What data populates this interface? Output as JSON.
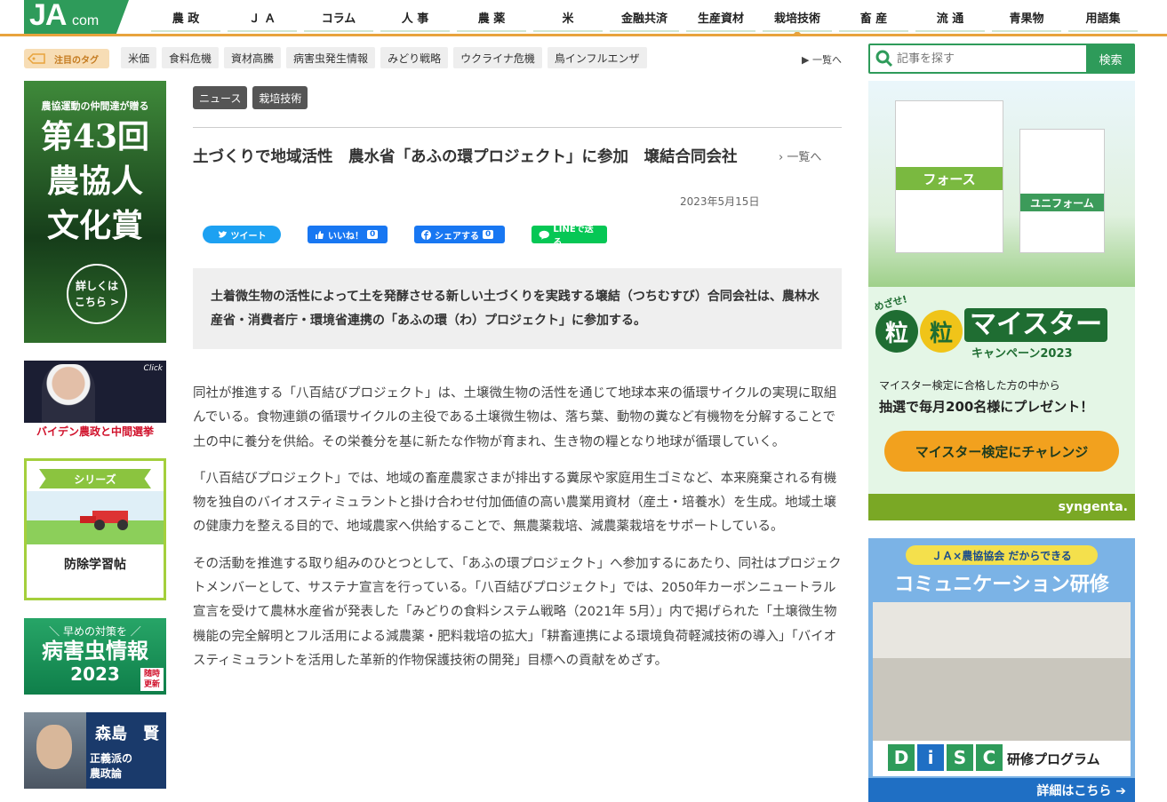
{
  "header": {
    "logo_ja": "JA",
    "logo_com": "com",
    "nav": [
      "農 政",
      "Ｊ Ａ",
      "コラム",
      "人 事",
      "農 薬",
      "米",
      "金融共済",
      "生産資材",
      "栽培技術",
      "畜 産",
      "流 通",
      "青果物",
      "用語集"
    ],
    "active_nav": "栽培技術"
  },
  "tags": {
    "label": "注目のタグ",
    "items": [
      "米価",
      "食料危機",
      "資材高騰",
      "病害虫発生情報",
      "みどり戦略",
      "ウクライナ危機",
      "鳥インフルエンザ"
    ],
    "all_link": "▶ 一覧へ"
  },
  "search": {
    "placeholder": "記事を探す",
    "button": "検索"
  },
  "left_banners": {
    "b1_sub": "農協運動の仲間達が贈る",
    "b1_line1": "第43回",
    "b1_line2": "農協人",
    "b1_line3": "文化賞",
    "b1_circle_1": "詳しくは",
    "b1_circle_2": "こちら >",
    "b2_click": "Click",
    "b2_caption": "バイデン農政と中間選挙",
    "b3_ribbon": "シリーズ",
    "b3_label": "防除学習帖",
    "b4_t1": "＼ 早めの対策を ／",
    "b4_t2": "病害虫情報",
    "b4_t3": "2023",
    "b4_badge_1": "随時",
    "b4_badge_2": "更新",
    "b5_name": "森島　賢",
    "b5_desc_1": "正義派の",
    "b5_desc_2": "農政論"
  },
  "article": {
    "categories": [
      "ニュース",
      "栽培技術"
    ],
    "title": "土づくりで地域活性　農水省「あふの環プロジェクト」に参加　壌結合同会社",
    "back_link": "› 一覧へ",
    "date": "2023年5月15日",
    "share": {
      "tweet": "ツイート",
      "like": "いいね！",
      "like_count": "0",
      "fb_share": "シェアする",
      "fb_share_count": "0",
      "line": "LINEで送る"
    },
    "lead": "土着微生物の活性によって土を発酵させる新しい土づくりを実践する壌結（つちむすび）合同会社は、農林水産省・消費者庁・環境省連携の「あふの環（わ）プロジェクト」に参加する。",
    "paragraphs": [
      "同社が推進する「八百結びプロジェクト」は、土壌微生物の活性を通じて地球本来の循環サイクルの実現に取組んでいる。食物連鎖の循環サイクルの主役である土壌微生物は、落ち葉、動物の糞など有機物を分解することで土の中に養分を供給。その栄養分を基に新たな作物が育まれ、生き物の糧となり地球が循環していく。",
      "「八百結びプロジェクト」では、地域の畜産農家さまが排出する糞尿や家庭用生ゴミなど、本来廃棄される有機物を独自のバイオスティミュラントと掛け合わせ付加価値の高い農業用資材（産土・培養水）を生成。地域土壌の健康力を整える目的で、地域農家へ供給することで、無農薬栽培、減農薬栽培をサポートしている。",
      "その活動を推進する取り組みのひとつとして、「あふの環プロジェクト」へ参加するにあたり、同社はプロジェクトメンバーとして、サステナ宣言を行っている。「八百結びプロジェクト」では、2050年カーボンニュートラル宣言を受けて農林水産省が発表した「みどりの食料システム戦略（2021年 5月）」内で掲げられた「土壌微生物機能の完全解明とフル活用による減農薬・肥料栽培の拡大」「耕畜連携による環境負荷軽減技術の導入」「バイオスティミュラントを活用した革新的作物保護技術の開発」目標への貢献をめざす。"
    ]
  },
  "right_banners": {
    "r1_bag1": "フォース",
    "r1_bag2": "ユニフォーム",
    "r1_megaze": "めざせ!",
    "r1_grain": "粒",
    "r1_meister": "マイスター",
    "r1_campaign": "キャンペーン2023",
    "r1_line1": "マイスター検定に合格した方の中から",
    "r1_line2": "抽選で毎月200名様にプレゼント！",
    "r1_cta": "マイスター検定にチャレンジ",
    "r1_brand": "syngenta.",
    "r2_top": "ＪＡ×農協協会 だからできる",
    "r2_head": "コミュニケーション研修",
    "r2_disc": [
      "D",
      "i",
      "S",
      "C"
    ],
    "r2_program": "研修プログラム",
    "r2_more": "詳細はこちら ➔"
  },
  "colors": {
    "brand_green": "#2e9b5a",
    "nav_orange": "#e8a33d",
    "disc": [
      "#2e9b5a",
      "#1f6fc4",
      "#2e9b5a",
      "#2e9b5a"
    ]
  }
}
